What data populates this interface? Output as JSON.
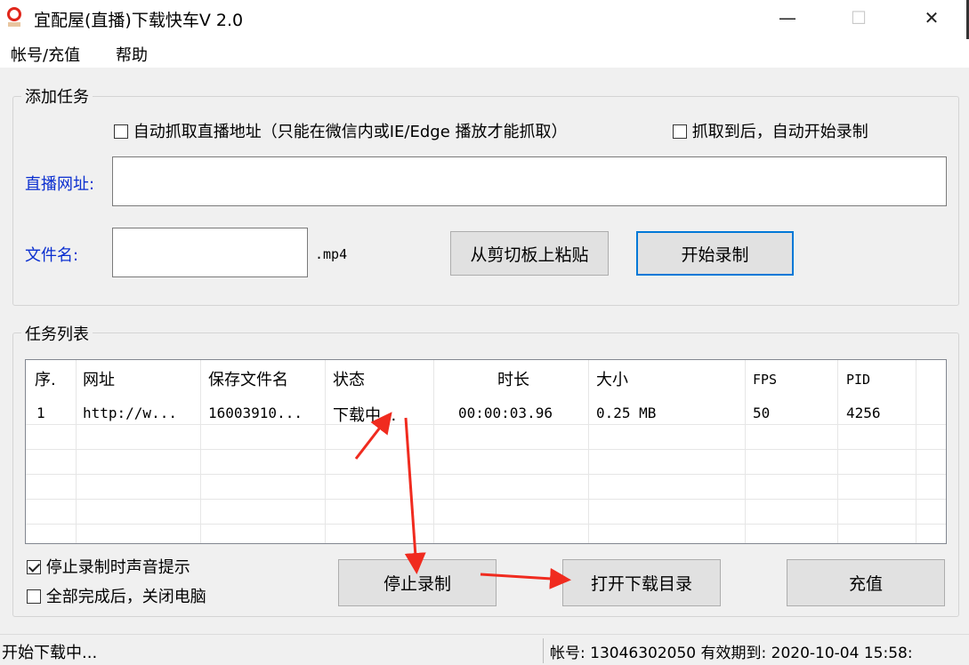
{
  "window": {
    "title": "宜配屋(直播)下载快车V 2.0",
    "minimize_glyph": "—",
    "maximize_glyph": "☐",
    "close_glyph": "✕",
    "icon": "app-logo-icon"
  },
  "menu": {
    "items": [
      "帐号/充值",
      "帮助"
    ]
  },
  "add_task": {
    "group_title": "添加任务",
    "auto_capture_label": "自动抓取直播地址（只能在微信内或IE/Edge 播放才能抓取）",
    "auto_capture_checked": false,
    "auto_start_label": "抓取到后，自动开始录制",
    "auto_start_checked": false,
    "url_label": "直播网址:",
    "url_value": "",
    "filename_label": "文件名:",
    "filename_value": "",
    "ext_label": ".mp4",
    "paste_button": "从剪切板上粘贴",
    "start_button": "开始录制"
  },
  "task_list": {
    "group_title": "任务列表",
    "columns": [
      "序.",
      "网址",
      "保存文件名",
      "状态",
      "时长",
      "大小",
      "FPS",
      "PID"
    ],
    "rows": [
      [
        "1",
        "http://w...",
        "16003910...",
        "下载中...",
        "00:00:03.96",
        "0.25 MB",
        "50",
        "4256"
      ]
    ]
  },
  "options": {
    "beep_label": "停止录制时声音提示",
    "beep_checked": true,
    "shutdown_label": "全部完成后，关闭电脑",
    "shutdown_checked": false
  },
  "buttons": {
    "stop": "停止录制",
    "open_dir": "打开下载目录",
    "recharge": "充值"
  },
  "status": {
    "left": "开始下载中...",
    "right": "帐号: 13046302050 有效期到: 2020-10-04 15:58:"
  },
  "colors": {
    "label_blue": "#0b2fd0",
    "arrow_red": "#f02b1f",
    "default_button_border": "#0078d7"
  }
}
